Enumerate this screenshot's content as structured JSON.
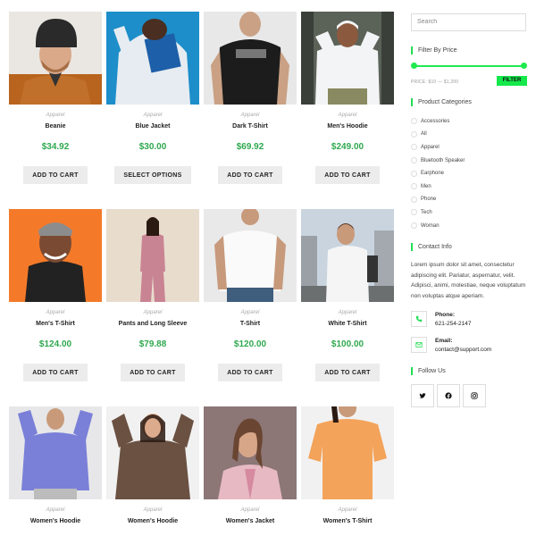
{
  "accent": "#2fa84f",
  "products": [
    {
      "category": "Apparel",
      "name": "Beanie",
      "price": "$34.92",
      "button": "ADD TO CART"
    },
    {
      "category": "Apparel",
      "name": "Blue Jacket",
      "price": "$30.00",
      "button": "SELECT OPTIONS"
    },
    {
      "category": "Apparel",
      "name": "Dark T-Shirt",
      "price": "$69.92",
      "button": "ADD TO CART"
    },
    {
      "category": "Apparel",
      "name": "Men's Hoodie",
      "price": "$249.00",
      "button": "ADD TO CART"
    },
    {
      "category": "Apparel",
      "name": "Men's T-Shirt",
      "price": "$124.00",
      "button": "ADD TO CART"
    },
    {
      "category": "Apparel",
      "name": "Pants and Long Sleeve",
      "price": "$79.88",
      "button": "ADD TO CART"
    },
    {
      "category": "Apparel",
      "name": "T-Shirt",
      "price": "$120.00",
      "button": "ADD TO CART"
    },
    {
      "category": "Apparel",
      "name": "White T-Shirt",
      "price": "$100.00",
      "button": "ADD TO CART"
    },
    {
      "category": "Apparel",
      "name": "Women's Hoodie"
    },
    {
      "category": "Apparel",
      "name": "Women's Hoodie"
    },
    {
      "category": "Apparel",
      "name": "Women's Jacket"
    },
    {
      "category": "Apparel",
      "name": "Women's T-Shirt"
    }
  ],
  "sidebar": {
    "search_placeholder": "Search",
    "filter": {
      "title": "Filter By Price",
      "price_label": "PRICE: $10 — $1,200",
      "button": "FILTER"
    },
    "categories": {
      "title": "Product Categories",
      "items": [
        "Accessories",
        "All",
        "Apparel",
        "Bluetooth Speaker",
        "Earphone",
        "Men",
        "Phone",
        "Tech",
        "Woman"
      ]
    },
    "contact": {
      "title": "Contact Info",
      "text": "Lorem ipsum dolor sit amet, consectetur adipiscing elit. Pariatur, aspernatur, velit. Adipisci, animi, molestiae, neque voluptatum non voluptas atque aperiam.",
      "phone_label": "Phone:",
      "phone": "621-254-2147",
      "email_label": "Email:",
      "email": "contact@support.com",
      "phone_icon": "phone-icon",
      "email_icon": "email-icon"
    },
    "follow": {
      "title": "Follow Us",
      "icons": [
        "twitter-icon",
        "facebook-icon",
        "instagram-icon"
      ]
    }
  }
}
